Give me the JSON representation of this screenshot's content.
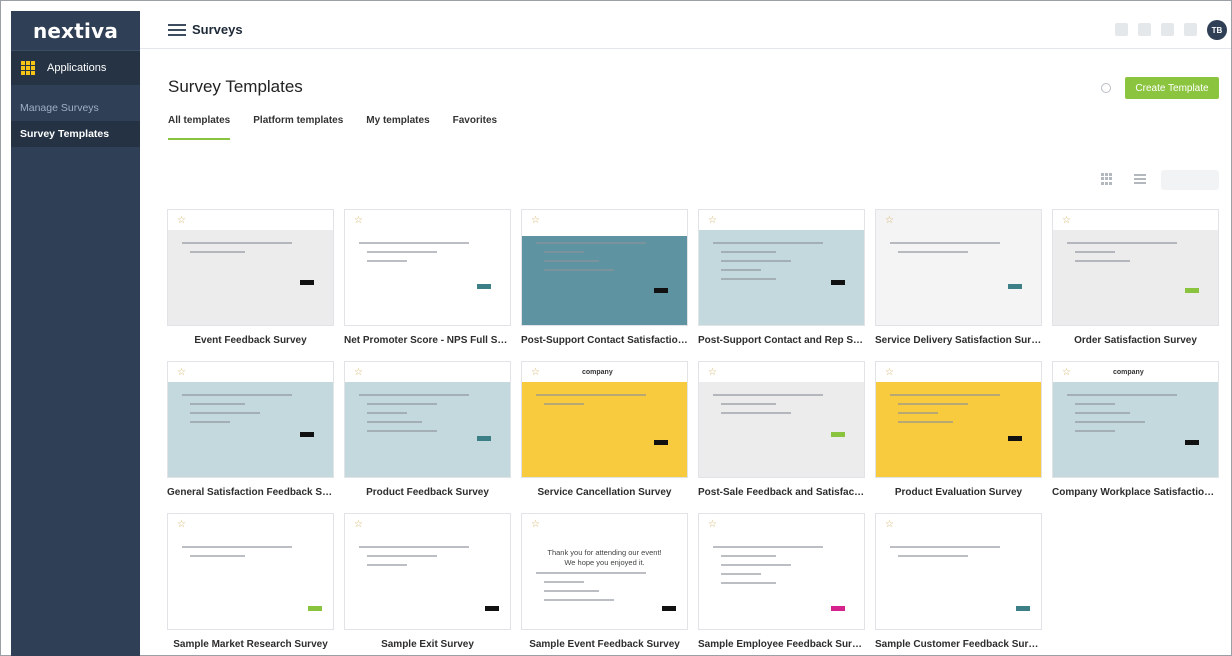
{
  "sidebar": {
    "logo": "nextiva",
    "apps_label": "Applications",
    "items": [
      {
        "label": "Manage Surveys",
        "active": false
      },
      {
        "label": "Survey Templates",
        "active": true
      }
    ]
  },
  "topbar": {
    "title": "Surveys",
    "avatar_initials": "TB"
  },
  "main": {
    "title": "Survey Templates",
    "create_label": "Create Template",
    "tabs": [
      {
        "label": "All templates",
        "active": true
      },
      {
        "label": "Platform templates",
        "active": false
      },
      {
        "label": "My templates",
        "active": false
      },
      {
        "label": "Favorites",
        "active": false
      }
    ]
  },
  "colors": {
    "sidebar": "#2f3f55",
    "accent": "#8bc53f",
    "teal": "#5e94a1",
    "light_teal": "#c4d9de",
    "yellow": "#f8ca3e",
    "grey": "#ededed"
  },
  "templates": [
    {
      "title": "Event Feedback Survey",
      "theme": "grey"
    },
    {
      "title": "Net Promoter Score - NPS Full Surv...",
      "theme": "white"
    },
    {
      "title": "Post-Support Contact Satisfaction ...",
      "theme": "teal"
    },
    {
      "title": "Post-Support Contact and Rep Satis...",
      "theme": "light_teal"
    },
    {
      "title": "Service Delivery Satisfaction Survey",
      "theme": "lightgrey"
    },
    {
      "title": "Order Satisfaction Survey",
      "theme": "grey"
    },
    {
      "title": "General Satisfaction Feedback Surv...",
      "theme": "light_teal"
    },
    {
      "title": "Product Feedback Survey",
      "theme": "light_teal"
    },
    {
      "title": "Service Cancellation Survey",
      "theme": "yellow",
      "thumb_logo": "company"
    },
    {
      "title": "Post-Sale Feedback and Satisfactio...",
      "theme": "grey"
    },
    {
      "title": "Product Evaluation Survey",
      "theme": "yellow"
    },
    {
      "title": "Company Workplace Satisfaction S...",
      "theme": "light_teal",
      "thumb_logo": "company"
    },
    {
      "title": "Sample Market Research Survey",
      "theme": "white"
    },
    {
      "title": "Sample Exit Survey",
      "theme": "white"
    },
    {
      "title": "Sample Event Feedback Survey",
      "theme": "white",
      "thumb_heading": "Thank you for attending our event!",
      "thumb_sub": "We hope you enjoyed it."
    },
    {
      "title": "Sample Employee Feedback Survey",
      "theme": "white"
    },
    {
      "title": "Sample Customer Feedback Survey",
      "theme": "white"
    }
  ]
}
